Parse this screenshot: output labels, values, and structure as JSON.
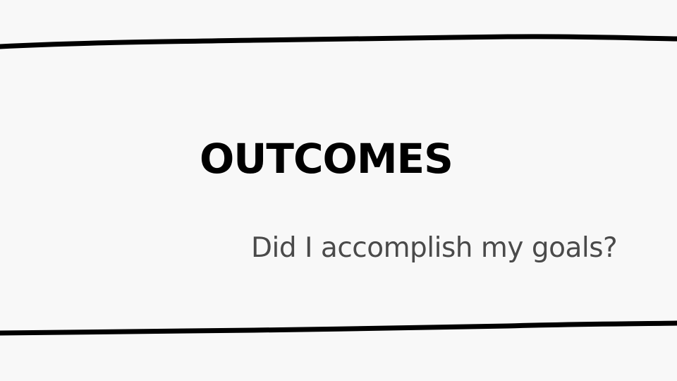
{
  "slide": {
    "title": "OUTCOMES",
    "subtitle": "Did I accomplish my goals?"
  },
  "colors": {
    "background": "#f8f8f8",
    "title": "#000000",
    "subtitle": "#4a4a4a",
    "rule": "#000000"
  }
}
